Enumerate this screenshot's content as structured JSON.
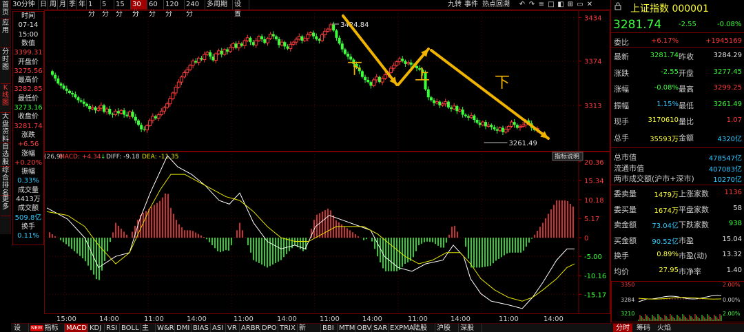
{
  "left_tabs": [
    "首页",
    "应用",
    "分时图",
    "K线图",
    "大盘资料",
    "自选股",
    "综合排名",
    "更多"
  ],
  "period_tabs": [
    "30分钟",
    "日",
    "周",
    "月",
    "季",
    "年",
    "1分",
    "5分",
    "15分",
    "30分",
    "60分",
    "120分",
    "240分",
    "多周期",
    "设置"
  ],
  "period_active": "30分",
  "top_right_items": [
    "九转",
    "事件",
    "热点回溯"
  ],
  "info_panel": {
    "rows": [
      {
        "text": "时间",
        "color": "white"
      },
      {
        "text": "07-14",
        "color": "white"
      },
      {
        "text": "15:00",
        "color": "white"
      },
      {
        "text": "数值",
        "color": "white"
      },
      {
        "text": "3399.31",
        "color": "red"
      },
      {
        "text": "开盘价",
        "color": "white"
      },
      {
        "text": "3275.56",
        "color": "red"
      },
      {
        "text": "最高价",
        "color": "white"
      },
      {
        "text": "3282.85",
        "color": "red"
      },
      {
        "text": "最低价",
        "color": "white"
      },
      {
        "text": "3273.16",
        "color": "green"
      },
      {
        "text": "收盘价",
        "color": "white"
      },
      {
        "text": "3281.74",
        "color": "red"
      },
      {
        "text": "涨跌",
        "color": "white"
      },
      {
        "text": "+6.56",
        "color": "red"
      },
      {
        "text": "涨幅",
        "color": "white"
      },
      {
        "text": "+0.20%",
        "color": "red"
      },
      {
        "text": "振幅",
        "color": "white"
      },
      {
        "text": "0.33%",
        "color": "cyan"
      },
      {
        "text": "成交量",
        "color": "white"
      },
      {
        "text": "4413万",
        "color": "white"
      },
      {
        "text": "成交额",
        "color": "white"
      },
      {
        "text": "509.8亿",
        "color": "cyan"
      },
      {
        "text": "换手",
        "color": "white"
      },
      {
        "text": "0.11%",
        "color": "cyan"
      }
    ]
  },
  "main_chart": {
    "price_axis": [
      "3434",
      "3374",
      "3313"
    ],
    "high_label": "3424.84",
    "low_label": "3261.49",
    "annotations": [
      "下",
      "上",
      "下"
    ]
  },
  "macd": {
    "params": "(26,9)",
    "macd_label": "MACD: +4.34",
    "diff_label": "DIFF: -9.18",
    "dea_label": "DEA: -11.35",
    "explain_button": "指标说明",
    "axis": [
      "20.36",
      "15.34",
      "10.18",
      "5.17",
      "0",
      "-5.00",
      "-10.16",
      "-15.17"
    ]
  },
  "time_axis": [
    "15:00",
    "14:00",
    "11:00",
    "14:00",
    "11:00",
    "14:00",
    "11:00",
    "14:00",
    "11:00",
    "14:00"
  ],
  "bottom_tabs": [
    "设置",
    "指标广场",
    "MACD",
    "KDJ",
    "RSI",
    "BOLL",
    "主力",
    "W&R",
    "DMI",
    "BIAS",
    "ASI",
    "VR",
    "ARBR",
    "DPO",
    "TRIX",
    "新DMA",
    "BBI",
    "MTM",
    "OBV",
    "SAR",
    "EXPMA",
    "陆股通",
    "沪股通",
    "深股通"
  ],
  "bottom_active": "MACD",
  "new_badge": "NEW",
  "right_panel": {
    "title": "上证指数 000001",
    "price": "3281.74",
    "change": "-2.55",
    "change_pct": "-0.08%",
    "weibi_label": "委比",
    "weibi_pct": "+6.17%",
    "weibi_val": "+1945169",
    "rows": [
      {
        "l1": "最新",
        "v1": "3281.74",
        "c1": "green",
        "l2": "昨收",
        "v2": "3284.29",
        "c2": "white"
      },
      {
        "l1": "涨跌",
        "v1": "-2.55",
        "c1": "green",
        "l2": "开盘",
        "v2": "3277.45",
        "c2": "green"
      },
      {
        "l1": "涨幅",
        "v1": "-0.08%",
        "c1": "green",
        "l2": "最高",
        "v2": "3299.25",
        "c2": "red"
      },
      {
        "l1": "振幅",
        "v1": "1.15%",
        "c1": "cyan",
        "l2": "最低",
        "v2": "3261.49",
        "c2": "green"
      },
      {
        "l1": "现手",
        "v1": "3170610",
        "c1": "yellow",
        "l2": "量比",
        "v2": "1.07",
        "c2": "red"
      },
      {
        "l1": "总手",
        "v1": "35593万",
        "c1": "yellow",
        "l2": "金额",
        "v2": "4320亿",
        "c2": "cyan"
      }
    ],
    "caps": [
      {
        "l": "总市值",
        "v": "478547亿"
      },
      {
        "l": "流通市值",
        "v": "407083亿"
      },
      {
        "l": "两市成交额(沪市+深市)",
        "v": "10270亿"
      }
    ],
    "rows2": [
      {
        "l1": "委卖量",
        "v1": "1479万",
        "c1": "yellow",
        "l2": "上涨家数",
        "v2": "1136",
        "c2": "red"
      },
      {
        "l1": "委买量",
        "v1": "1674万",
        "c1": "yellow",
        "l2": "平盘家数",
        "v2": "58",
        "c2": "white"
      },
      {
        "l1": "卖金额",
        "v1": "73.04亿",
        "c1": "cyan",
        "l2": "下跌家数",
        "v2": "938",
        "c2": "green"
      },
      {
        "l1": "买金额",
        "v1": "90.52亿",
        "c1": "cyan",
        "l2": "市盈",
        "v2": "15.04",
        "c2": "white"
      },
      {
        "l1": "换手",
        "v1": "0.89%",
        "c1": "yellow",
        "l2": "市盈(动)",
        "v2": "13.32",
        "c2": "white"
      },
      {
        "l1": "均价",
        "v1": "27.95",
        "c1": "yellow",
        "l2": "市净率",
        "v2": "1.40",
        "c2": "white"
      }
    ],
    "mini": {
      "left_axis": [
        "3350",
        "3284",
        "3210"
      ],
      "right_axis": [
        "2.00%",
        "0.00%",
        "2.00%"
      ]
    },
    "bottom_tabs": [
      "分时",
      "筹码",
      "火焰"
    ],
    "bottom_active": "分时"
  },
  "colors": {
    "up": "#ff3c3c",
    "down": "#3cff3c",
    "arrow": "#f0b400",
    "diff": "#ffffff",
    "dea": "#e6e600"
  }
}
